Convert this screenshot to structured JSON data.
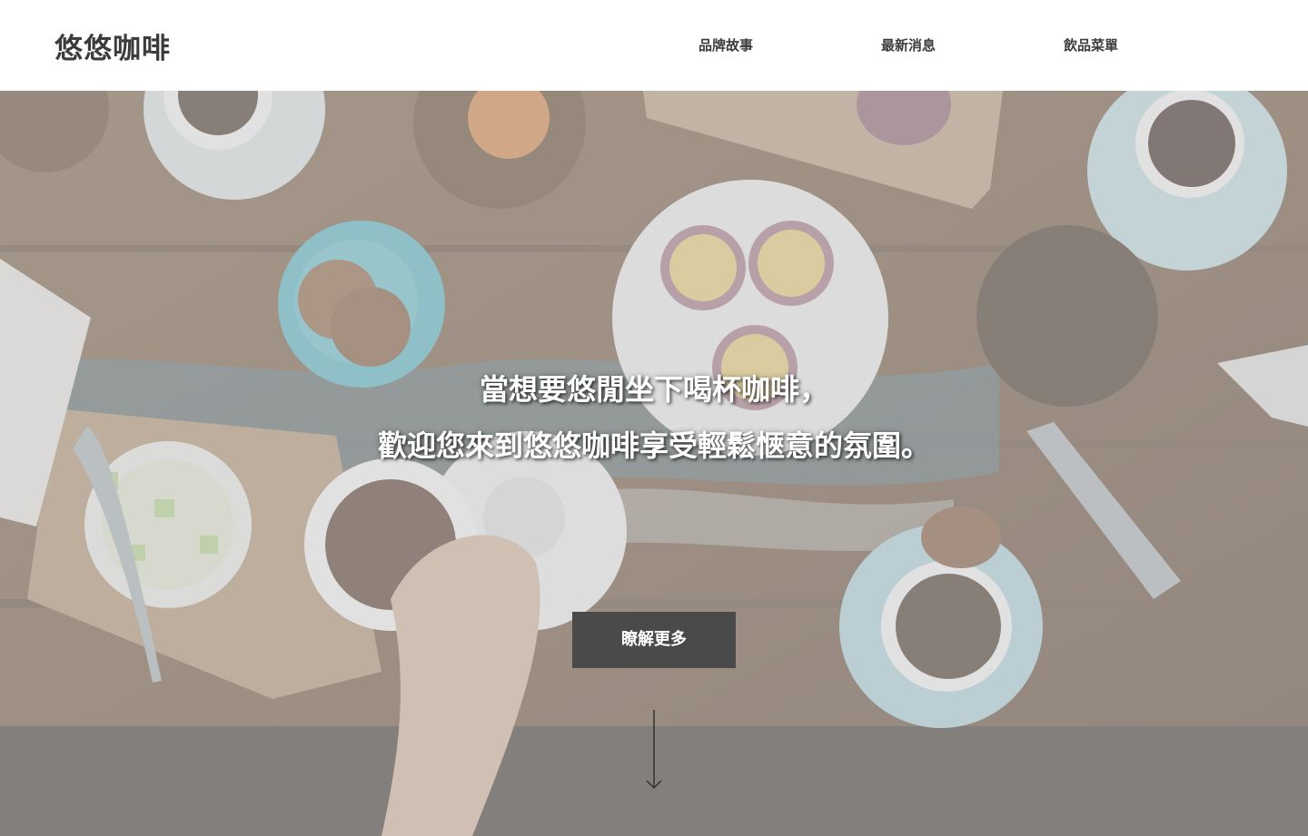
{
  "header": {
    "logo": "悠悠咖啡",
    "nav": [
      {
        "label": "品牌故事"
      },
      {
        "label": "最新消息"
      },
      {
        "label": "飲品菜單"
      }
    ]
  },
  "hero": {
    "line1": "當想要悠閒坐下喝杯咖啡，",
    "line2": "歡迎您來到悠悠咖啡享受輕鬆愜意的氛圍。",
    "cta": "瞭解更多",
    "scroll_icon": "arrow-down-icon"
  },
  "colors": {
    "header_bg": "#ffffff",
    "text_dark": "#3c3c3c",
    "button_bg": "#4a4a4a",
    "overlay": "#c8c8c8"
  }
}
